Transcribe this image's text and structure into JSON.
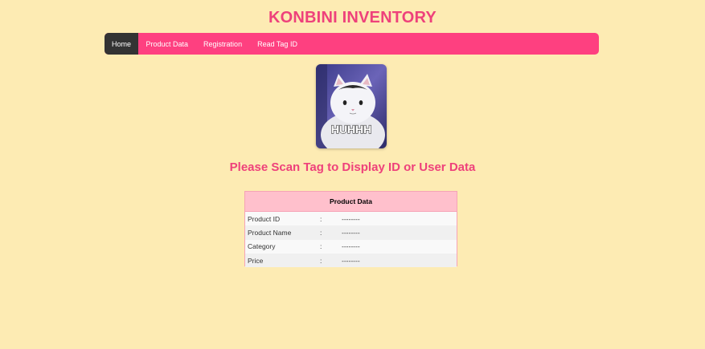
{
  "header": {
    "title": "KONBINI INVENTORY"
  },
  "nav": {
    "items": [
      {
        "label": "Home",
        "active": true
      },
      {
        "label": "Product Data",
        "active": false
      },
      {
        "label": "Registration",
        "active": false
      },
      {
        "label": "Read Tag ID",
        "active": false
      }
    ]
  },
  "image": {
    "caption": "HUHHH"
  },
  "prompt": {
    "text": "Please Scan Tag to Display ID or User Data"
  },
  "product_table": {
    "title": "Product Data",
    "rows": [
      {
        "label": "Product ID",
        "sep": ":",
        "value": "--------"
      },
      {
        "label": "Product Name",
        "sep": ":",
        "value": "--------"
      },
      {
        "label": "Category",
        "sep": ":",
        "value": "--------"
      },
      {
        "label": "Price",
        "sep": ":",
        "value": "--------"
      }
    ]
  },
  "colors": {
    "background": "#fdebb3",
    "accent": "#fe4080",
    "title": "#ee417b",
    "nav_active": "#333333",
    "table_header": "#ffc0cc"
  }
}
